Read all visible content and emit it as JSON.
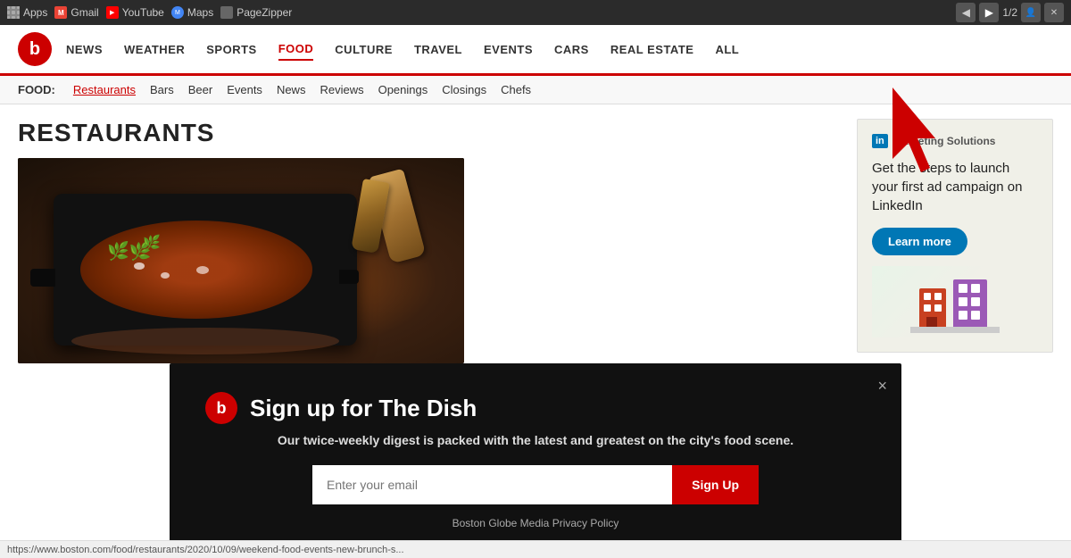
{
  "browser": {
    "toolbar": {
      "apps_label": "Apps",
      "gmail_label": "Gmail",
      "youtube_label": "YouTube",
      "maps_label": "Maps",
      "pagezipper_label": "PageZipper",
      "page_counter": "1/2",
      "back_btn": "◀",
      "forward_btn": "▶"
    }
  },
  "site": {
    "logo_letter": "b",
    "nav": [
      {
        "label": "NEWS",
        "active": false
      },
      {
        "label": "WEATHER",
        "active": false
      },
      {
        "label": "SPORTS",
        "active": false
      },
      {
        "label": "FOOD",
        "active": true
      },
      {
        "label": "CULTURE",
        "active": false
      },
      {
        "label": "TRAVEL",
        "active": false
      },
      {
        "label": "EVENTS",
        "active": false
      },
      {
        "label": "CARS",
        "active": false
      },
      {
        "label": "REAL ESTATE",
        "active": false
      },
      {
        "label": "ALL",
        "active": false
      }
    ],
    "subnav": {
      "label": "FOOD:",
      "items": [
        {
          "label": "Restaurants",
          "active": true
        },
        {
          "label": "Bars",
          "active": false
        },
        {
          "label": "Beer",
          "active": false
        },
        {
          "label": "Events",
          "active": false
        },
        {
          "label": "News",
          "active": false
        },
        {
          "label": "Reviews",
          "active": false
        },
        {
          "label": "Openings",
          "active": false
        },
        {
          "label": "Closings",
          "active": false
        },
        {
          "label": "Chefs",
          "active": false
        }
      ]
    }
  },
  "main": {
    "section_title": "RESTAURANTS"
  },
  "ad": {
    "linkedin_logo": "in",
    "linkedin_tagline": "Marketing Solutions",
    "linkedin_text": "Get the steps to launch your first ad campaign on LinkedIn",
    "learn_more_btn": "Learn more"
  },
  "modal": {
    "logo_letter": "b",
    "title": "Sign up for The Dish",
    "description": "Our twice-weekly digest is packed with the latest and greatest on the city's food scene.",
    "email_placeholder": "Enter your email",
    "signup_btn": "Sign Up",
    "footer": "Boston Globe Media Privacy Policy",
    "close_btn": "×"
  },
  "status_bar": {
    "url": "https://www.boston.com/food/restaurants/2020/10/09/weekend-food-events-new-brunch-s..."
  }
}
